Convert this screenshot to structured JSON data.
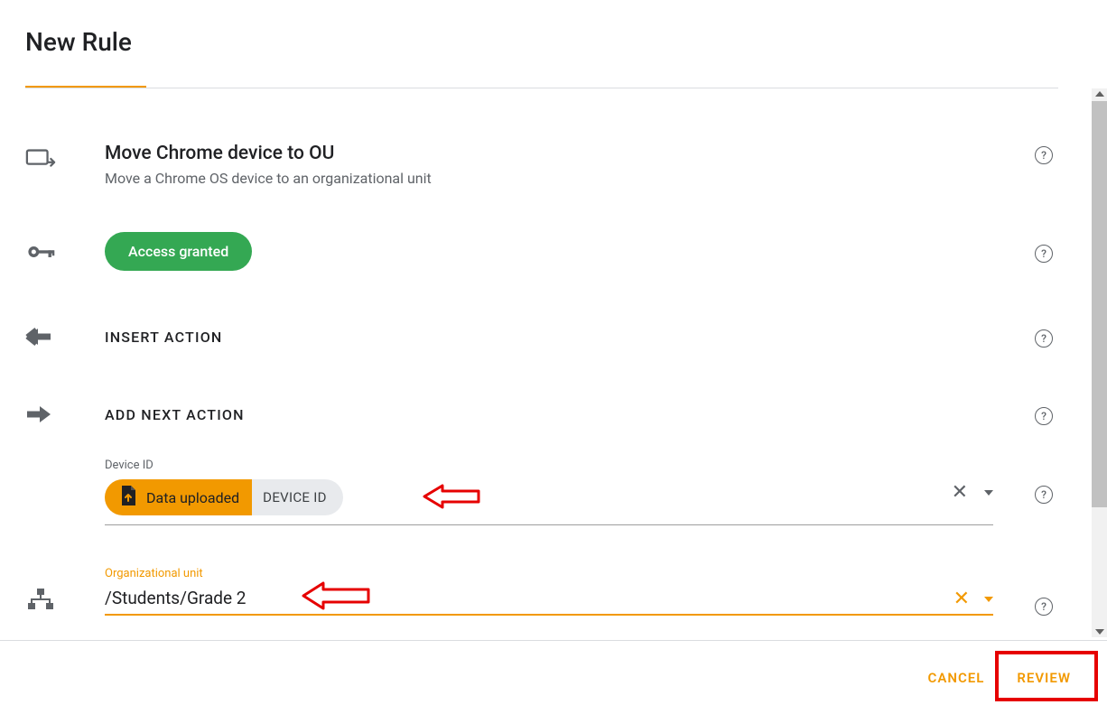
{
  "page": {
    "title": "New Rule"
  },
  "move": {
    "title": "Move Chrome device to OU",
    "desc": "Move a Chrome OS device to an organizational unit"
  },
  "access": {
    "chip_label": "Access granted"
  },
  "insert": {
    "label": "INSERT ACTION"
  },
  "addnext": {
    "label": "ADD NEXT ACTION"
  },
  "device": {
    "field_label": "Device ID",
    "chip_left": "Data uploaded",
    "chip_right": "DEVICE ID"
  },
  "ou": {
    "field_label": "Organizational unit",
    "value": "/Students/Grade 2"
  },
  "footer": {
    "cancel": "CANCEL",
    "review": "REVIEW"
  },
  "help_glyph": "?"
}
